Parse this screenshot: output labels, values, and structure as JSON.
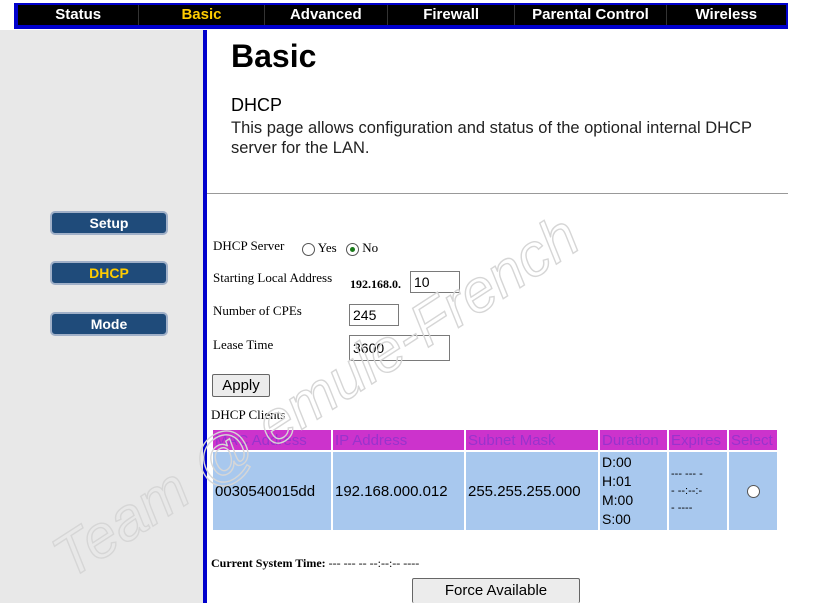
{
  "nav": {
    "tabs": [
      {
        "label": "Status",
        "active": false
      },
      {
        "label": "Basic",
        "active": true
      },
      {
        "label": "Advanced",
        "active": false
      },
      {
        "label": "Firewall",
        "active": false
      },
      {
        "label": "Parental Control",
        "active": false
      },
      {
        "label": "Wireless",
        "active": false
      }
    ]
  },
  "sidebar": {
    "items": [
      {
        "label": "Setup",
        "active": false
      },
      {
        "label": "DHCP",
        "active": true
      },
      {
        "label": "Mode",
        "active": false
      }
    ]
  },
  "page": {
    "title": "Basic",
    "section_title": "DHCP",
    "description": "This page allows configuration and status of the optional internal DHCP server for the LAN."
  },
  "form": {
    "dhcp_server_label": "DHCP Server",
    "yes_label": "Yes",
    "no_label": "No",
    "dhcp_server_value": "No",
    "starting_address_label": "Starting Local Address",
    "address_prefix": "192.168.0.",
    "starting_address_value": "10",
    "cpes_label": "Number of CPEs",
    "cpes_value": "245",
    "lease_time_label": "Lease Time",
    "lease_time_value": "3600",
    "apply_label": "Apply"
  },
  "clients": {
    "title": "DHCP Clients",
    "headers": [
      "MAC Address",
      "IP Address",
      "Subnet Mask",
      "Duration",
      "Expires",
      "Select"
    ],
    "rows": [
      {
        "mac": "0030540015dd",
        "ip": "192.168.000.012",
        "mask": "255.255.255.000",
        "duration": [
          "D:00",
          "H:01",
          "M:00",
          "S:00"
        ],
        "expires": [
          "--- --- -",
          "- --:--:-",
          "- ----"
        ],
        "selected": false
      }
    ]
  },
  "system_time": {
    "label": "Current System Time:",
    "value": "--- --- -- --:--:-- ----"
  },
  "force_available_label": "Force Available",
  "watermark": "Team @ emule-French",
  "colors": {
    "nav_bg": "#000000",
    "nav_frame": "#0000cc",
    "nav_active": "#ffcc00",
    "sidebar_button": "#1f4b7a",
    "table_header": "#cc33cc",
    "table_row": "#a8c8ee"
  }
}
